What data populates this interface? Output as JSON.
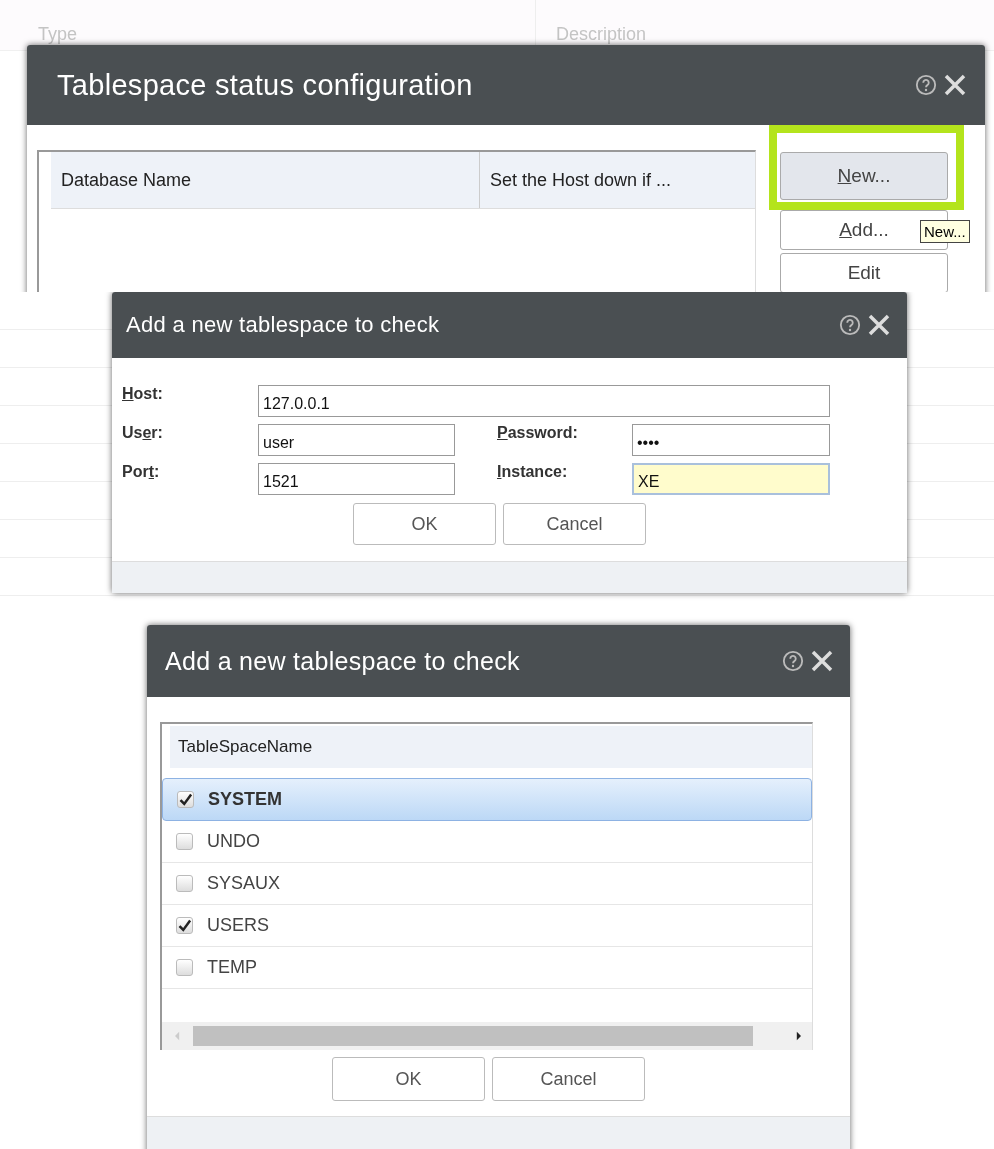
{
  "config_screen": {
    "background_columns": [
      "Type",
      "Description"
    ],
    "dialog": {
      "title": "Tablespace status configuration",
      "table": {
        "columns": [
          "Database Name",
          "Set the Host down if ..."
        ]
      },
      "buttons": [
        {
          "mnemonic": "N",
          "after": "ew...",
          "highlighted": true
        },
        {
          "mnemonic": "A",
          "after": "dd...",
          "highlighted": false
        },
        {
          "before": "Edit",
          "highlighted": false
        }
      ],
      "tooltip": "New..."
    }
  },
  "connection_dialog": {
    "title": "Add a new tablespace to check",
    "fields": [
      {
        "kind": "wide",
        "mnemonic": "H",
        "after": "ost:",
        "value": "127.0.0.1",
        "focused": false
      },
      {
        "kind": "half",
        "before": "Us",
        "mnemonic": "e",
        "after": "r:",
        "value": "user",
        "focused": false
      },
      {
        "kind": "half",
        "mnemonic": "P",
        "after": "assword:",
        "value": "••••",
        "focused": false
      },
      {
        "kind": "half",
        "before": "Por",
        "mnemonic": "t",
        "after": ":",
        "value": "1521",
        "focused": false
      },
      {
        "kind": "half",
        "mnemonic": "I",
        "after": "nstance:",
        "value": "XE",
        "focused": true
      }
    ],
    "buttons": [
      "OK",
      "Cancel"
    ]
  },
  "tablespace_dialog": {
    "title": "Add a new tablespace to check",
    "table": {
      "columns": [
        "TableSpaceName"
      ],
      "rows": [
        {
          "name": "SYSTEM",
          "checked": true,
          "selected": true
        },
        {
          "name": "UNDO",
          "checked": false,
          "selected": false
        },
        {
          "name": "SYSAUX",
          "checked": false,
          "selected": false
        },
        {
          "name": "USERS",
          "checked": true,
          "selected": false
        },
        {
          "name": "TEMP",
          "checked": false,
          "selected": false
        }
      ]
    },
    "buttons": [
      "OK",
      "Cancel"
    ]
  }
}
